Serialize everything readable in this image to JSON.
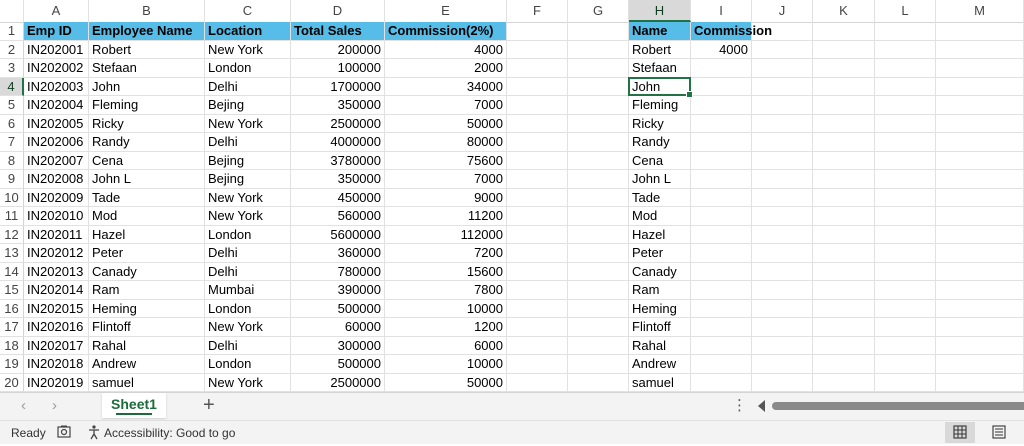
{
  "columns": [
    "A",
    "B",
    "C",
    "D",
    "E",
    "F",
    "G",
    "H",
    "I",
    "J",
    "K",
    "L",
    "M"
  ],
  "selected_column": "H",
  "selected_row": 4,
  "table": {
    "headers": [
      "Emp ID",
      "Employee Name",
      "Location",
      "Total Sales",
      "Commission(2%)"
    ],
    "rows": [
      [
        "IN202001",
        "Robert",
        "New York",
        "200000",
        "4000"
      ],
      [
        "IN202002",
        "Stefaan",
        "London",
        "100000",
        "2000"
      ],
      [
        "IN202003",
        "John",
        "Delhi",
        "1700000",
        "34000"
      ],
      [
        "IN202004",
        "Fleming",
        "Bejing",
        "350000",
        "7000"
      ],
      [
        "IN202005",
        "Ricky",
        "New York",
        "2500000",
        "50000"
      ],
      [
        "IN202006",
        "Randy",
        "Delhi",
        "4000000",
        "80000"
      ],
      [
        "IN202007",
        "Cena",
        "Bejing",
        "3780000",
        "75600"
      ],
      [
        "IN202008",
        "John L",
        "Bejing",
        "350000",
        "7000"
      ],
      [
        "IN202009",
        "Tade",
        "New York",
        "450000",
        "9000"
      ],
      [
        "IN202010",
        "Mod",
        "New York",
        "560000",
        "11200"
      ],
      [
        "IN202011",
        "Hazel",
        "London",
        "5600000",
        "112000"
      ],
      [
        "IN202012",
        "Peter",
        "Delhi",
        "360000",
        "7200"
      ],
      [
        "IN202013",
        "Canady",
        "Delhi",
        "780000",
        "15600"
      ],
      [
        "IN202014",
        "Ram",
        "Mumbai",
        "390000",
        "7800"
      ],
      [
        "IN202015",
        "Heming",
        "London",
        "500000",
        "10000"
      ],
      [
        "IN202016",
        "Flintoff",
        "New York",
        "60000",
        "1200"
      ],
      [
        "IN202017",
        "Rahal",
        "Delhi",
        "300000",
        "6000"
      ],
      [
        "IN202018",
        "Andrew",
        "London",
        "500000",
        "10000"
      ],
      [
        "IN202019",
        "samuel",
        "New York",
        "2500000",
        "50000"
      ]
    ]
  },
  "lookup": {
    "headers": [
      "Name",
      "Commission"
    ],
    "names": [
      "Robert",
      "Stefaan",
      "John",
      "Fleming",
      "Ricky",
      "Randy",
      "Cena",
      "John L",
      "Tade",
      "Mod",
      "Hazel",
      "Peter",
      "Canady",
      "Ram",
      "Heming",
      "Flintoff",
      "Rahal",
      "Andrew",
      "samuel"
    ],
    "commission_values": [
      "4000"
    ]
  },
  "sheet_tabs": {
    "active": "Sheet1",
    "add_label": "+"
  },
  "nav": {
    "prev": "‹",
    "next": "›",
    "more": "⋮"
  },
  "status": {
    "ready": "Ready",
    "accessibility": "Accessibility: Good to go"
  },
  "colors": {
    "header_fill": "#56bde8",
    "accent": "#217346"
  }
}
